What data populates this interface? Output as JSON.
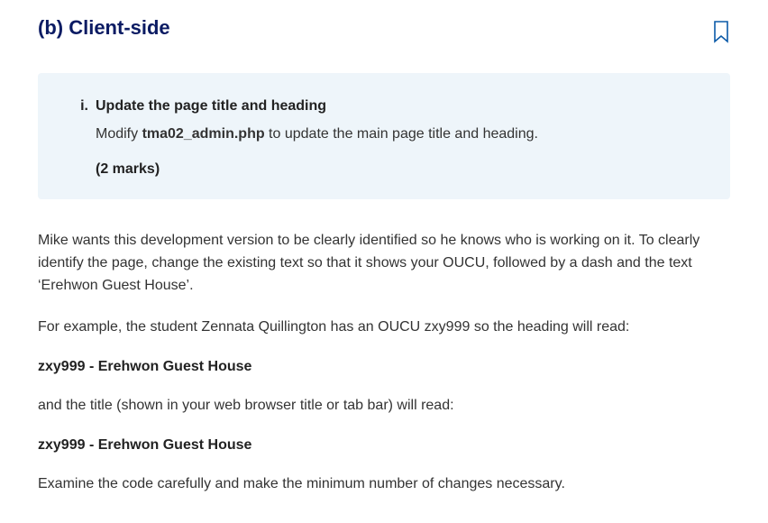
{
  "heading": "(b) Client-side",
  "box": {
    "marker": "i.",
    "title": "Update the page title and heading",
    "body_pre": "Modify ",
    "filename": "tma02_admin.php",
    "body_post": " to update the main page title and heading.",
    "marks": "(2 marks)"
  },
  "para1": "Mike wants this development version to be clearly identified so he knows who is working on it. To clearly identify the page, change the existing text so that it shows your OUCU, followed by a dash and the text ‘Erehwon Guest House’.",
  "para2": "For example, the student Zennata Quillington has an OUCU zxy999 so the heading will read:",
  "example1": "zxy999 - Erehwon Guest House",
  "para3": "and the title (shown in your web browser title or tab bar) will read:",
  "example2": "zxy999 - Erehwon Guest House",
  "para4": "Examine the code carefully and make the minimum number of changes necessary."
}
